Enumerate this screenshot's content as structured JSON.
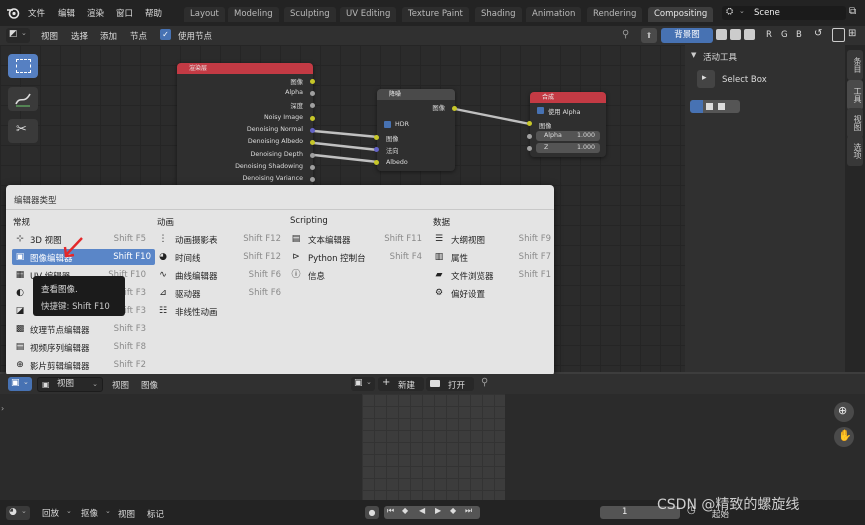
{
  "topbar": {
    "menus": [
      "文件",
      "编辑",
      "渲染",
      "窗口",
      "帮助"
    ],
    "workspace_tabs": [
      "Layout",
      "Modeling",
      "Sculpting",
      "UV Editing",
      "Texture Paint",
      "Shading",
      "Animation",
      "Rendering",
      "Compositing"
    ],
    "active_tab": "Compositing",
    "scene_label": "Scene"
  },
  "node_header": {
    "menus": [
      "视图",
      "选择",
      "添加",
      "节点"
    ],
    "use_nodes": "使用节点",
    "backdrop": "背景图",
    "channel_letters": [
      "R",
      "G",
      "B"
    ]
  },
  "nodes": {
    "render_layers": {
      "title": "渲染层",
      "outputs": [
        "图像",
        "Alpha",
        "深度",
        "Noisy Image",
        "Denoising Normal",
        "Denoising Albedo",
        "Denoising Depth",
        "Denoising Shadowing",
        "Denoising Variance"
      ]
    },
    "denoise": {
      "title": "降噪",
      "output": "图像",
      "hdr": "HDR",
      "inputs": [
        "图像",
        "法向",
        "Albedo"
      ]
    },
    "composite": {
      "title": "合成",
      "use_alpha": "使用 Alpha",
      "image": "图像",
      "alpha_label": "Alpha",
      "alpha_value": "1.000",
      "z_label": "Z",
      "z_value": "1.000"
    }
  },
  "sidebar": {
    "section": "活动工具",
    "tool": "Select Box",
    "tabs": [
      "条目",
      "工具",
      "视图",
      "选项"
    ]
  },
  "popup": {
    "title": "编辑器类型",
    "columns": [
      {
        "category": "常规",
        "items": [
          {
            "label": "3D 视图",
            "key": "Shift F5",
            "icon": "3d-viewport-icon"
          },
          {
            "label": "图像编辑器",
            "key": "Shift F10",
            "icon": "image-editor-icon",
            "highlighted": true
          },
          {
            "label": "UV 编辑器",
            "key": "Shift F10",
            "icon": "uv-editor-icon"
          },
          {
            "label": "",
            "key": "Shift F3",
            "icon": "shader-editor-icon"
          },
          {
            "label": "",
            "key": "Shift F3",
            "icon": "compositor-icon"
          },
          {
            "label": "纹理节点编辑器",
            "key": "Shift F3",
            "icon": "texture-node-icon"
          },
          {
            "label": "视频序列编辑器",
            "key": "Shift F8",
            "icon": "sequencer-icon"
          },
          {
            "label": "影片剪辑编辑器",
            "key": "Shift F2",
            "icon": "movie-clip-icon"
          }
        ]
      },
      {
        "category": "动画",
        "items": [
          {
            "label": "动画摄影表",
            "key": "Shift F12",
            "icon": "dopesheet-icon"
          },
          {
            "label": "时间线",
            "key": "Shift F12",
            "icon": "timeline-icon"
          },
          {
            "label": "曲线编辑器",
            "key": "Shift F6",
            "icon": "graph-editor-icon"
          },
          {
            "label": "驱动器",
            "key": "Shift F6",
            "icon": "drivers-icon"
          },
          {
            "label": "非线性动画",
            "key": "",
            "icon": "nla-icon"
          }
        ]
      },
      {
        "category": "Scripting",
        "items": [
          {
            "label": "文本编辑器",
            "key": "Shift F11",
            "icon": "text-editor-icon"
          },
          {
            "label": "Python 控制台",
            "key": "Shift F4",
            "icon": "python-console-icon"
          },
          {
            "label": "信息",
            "key": "",
            "icon": "info-icon"
          }
        ]
      },
      {
        "category": "数据",
        "items": [
          {
            "label": "大纲视图",
            "key": "Shift F9",
            "icon": "outliner-icon"
          },
          {
            "label": "属性",
            "key": "Shift F7",
            "icon": "properties-icon"
          },
          {
            "label": "文件浏览器",
            "key": "Shift F1",
            "icon": "file-browser-icon"
          },
          {
            "label": "偏好设置",
            "key": "",
            "icon": "preferences-icon"
          }
        ]
      }
    ]
  },
  "tooltip": {
    "line1": "查看图像.",
    "line2": "快捷键: Shift F10"
  },
  "image_header": {
    "mode": "视图",
    "menus": [
      "视图",
      "图像"
    ],
    "new": "新建",
    "open": "打开"
  },
  "timeline": {
    "playback": "回放",
    "keying": "抠像",
    "menus": [
      "视图",
      "标记"
    ],
    "current_frame": "1",
    "start_label": "起始"
  },
  "watermark": "CSDN @精致的螺旋线"
}
